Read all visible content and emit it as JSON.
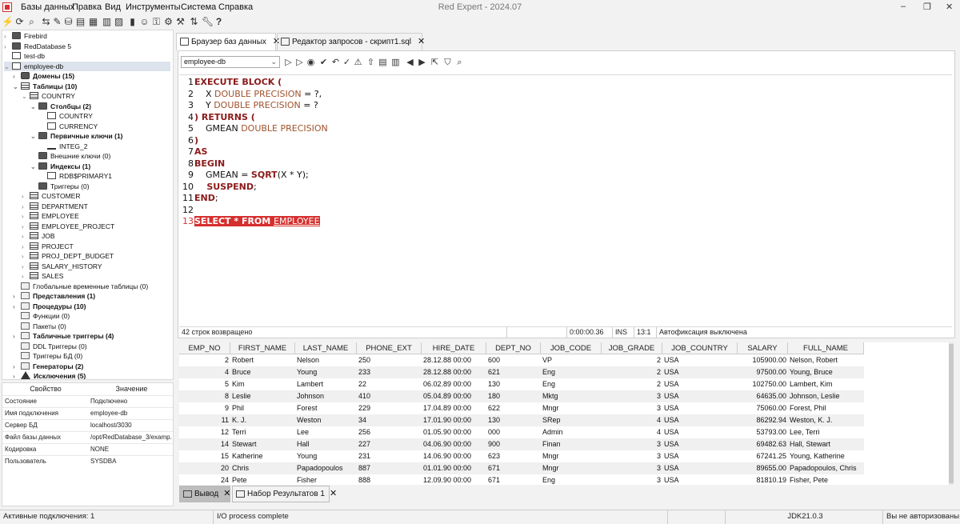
{
  "app": {
    "title": "Red Expert - 2024.07"
  },
  "menu": [
    "Базы данных",
    "Правка",
    "Вид",
    "Инструменты",
    "Система",
    "Справка"
  ],
  "tree": [
    {
      "label": "Firebird",
      "depth": 0,
      "icon": "fld",
      "arrow": "›",
      "bold": false
    },
    {
      "label": "RedDatabase 5",
      "depth": 0,
      "icon": "fld",
      "arrow": "›",
      "bold": false
    },
    {
      "label": "test-db",
      "depth": 0,
      "icon": "col",
      "arrow": "",
      "bold": false
    },
    {
      "label": "employee-db",
      "depth": 0,
      "icon": "col",
      "arrow": "⌄",
      "bold": false,
      "selected": true
    },
    {
      "label": "Домены (15)",
      "depth": 1,
      "icon": "db",
      "arrow": "›",
      "bold": true
    },
    {
      "label": "Таблицы (10)",
      "depth": 1,
      "icon": "tbl",
      "arrow": "⌄",
      "bold": true
    },
    {
      "label": "COUNTRY",
      "depth": 2,
      "icon": "tbl",
      "arrow": "⌄",
      "bold": false
    },
    {
      "label": "Столбцы (2)",
      "depth": 3,
      "icon": "fld",
      "arrow": "⌄",
      "bold": true
    },
    {
      "label": "COUNTRY",
      "depth": 4,
      "icon": "col",
      "arrow": "",
      "bold": false
    },
    {
      "label": "CURRENCY",
      "depth": 4,
      "icon": "col",
      "arrow": "",
      "bold": false
    },
    {
      "label": "Первичные ключи (1)",
      "depth": 3,
      "icon": "fld",
      "arrow": "⌄",
      "bold": true
    },
    {
      "label": "INTEG_2",
      "depth": 4,
      "icon": "key",
      "arrow": "",
      "bold": false
    },
    {
      "label": "Внешние ключи (0)",
      "depth": 3,
      "icon": "fld",
      "arrow": "",
      "bold": false
    },
    {
      "label": "Индексы (1)",
      "depth": 3,
      "icon": "fld",
      "arrow": "⌄",
      "bold": true
    },
    {
      "label": "RDB$PRIMARY1",
      "depth": 4,
      "icon": "col",
      "arrow": "",
      "bold": false
    },
    {
      "label": "Триггеры (0)",
      "depth": 3,
      "icon": "fld",
      "arrow": "",
      "bold": false
    },
    {
      "label": "CUSTOMER",
      "depth": 2,
      "icon": "tbl",
      "arrow": "›",
      "bold": false
    },
    {
      "label": "DEPARTMENT",
      "depth": 2,
      "icon": "tbl",
      "arrow": "›",
      "bold": false
    },
    {
      "label": "EMPLOYEE",
      "depth": 2,
      "icon": "tbl",
      "arrow": "›",
      "bold": false
    },
    {
      "label": "EMPLOYEE_PROJECT",
      "depth": 2,
      "icon": "tbl",
      "arrow": "›",
      "bold": false
    },
    {
      "label": "JOB",
      "depth": 2,
      "icon": "tbl",
      "arrow": "›",
      "bold": false
    },
    {
      "label": "PROJECT",
      "depth": 2,
      "icon": "tbl",
      "arrow": "›",
      "bold": false
    },
    {
      "label": "PROJ_DEPT_BUDGET",
      "depth": 2,
      "icon": "tbl",
      "arrow": "›",
      "bold": false
    },
    {
      "label": "SALARY_HISTORY",
      "depth": 2,
      "icon": "tbl",
      "arrow": "›",
      "bold": false
    },
    {
      "label": "SALES",
      "depth": 2,
      "icon": "tbl",
      "arrow": "›",
      "bold": false
    },
    {
      "label": "Глобальные временные таблицы (0)",
      "depth": 1,
      "icon": "gen",
      "arrow": "",
      "bold": false
    },
    {
      "label": "Представления (1)",
      "depth": 1,
      "icon": "gen",
      "arrow": "›",
      "bold": true
    },
    {
      "label": "Процедуры (10)",
      "depth": 1,
      "icon": "gen",
      "arrow": "›",
      "bold": true
    },
    {
      "label": "Функции (0)",
      "depth": 1,
      "icon": "gen",
      "arrow": "",
      "bold": false
    },
    {
      "label": "Пакеты (0)",
      "depth": 1,
      "icon": "gen",
      "arrow": "",
      "bold": false
    },
    {
      "label": "Табличные триггеры (4)",
      "depth": 1,
      "icon": "gen",
      "arrow": "›",
      "bold": true
    },
    {
      "label": "DDL Триггеры (0)",
      "depth": 1,
      "icon": "gen",
      "arrow": "",
      "bold": false
    },
    {
      "label": "Триггеры БД (0)",
      "depth": 1,
      "icon": "gen",
      "arrow": "",
      "bold": false
    },
    {
      "label": "Генераторы (2)",
      "depth": 1,
      "icon": "gen",
      "arrow": "›",
      "bold": true
    },
    {
      "label": "Исключения (5)",
      "depth": 1,
      "icon": "warn",
      "arrow": "›",
      "bold": true
    }
  ],
  "props": {
    "header_prop": "Свойство",
    "header_val": "Значение",
    "rows": [
      {
        "k": "Состояние",
        "v": "Подключено"
      },
      {
        "k": "Имя подключения",
        "v": "employee-db"
      },
      {
        "k": "Сервер БД",
        "v": "localhost/3030"
      },
      {
        "k": "Файл базы данных",
        "v": "/opt/RedDatabase_3/examp..."
      },
      {
        "k": "Кодировка",
        "v": "NONE"
      },
      {
        "k": "Пользователь",
        "v": "SYSDBA"
      }
    ]
  },
  "tabs": [
    {
      "label": "Браузер баз данных",
      "active": true
    },
    {
      "label": "Редактор запросов - скрипт1.sql",
      "active": false
    }
  ],
  "editor": {
    "connection": "employee-db",
    "lines": [
      [
        [
          "kw",
          "EXECUTE BLOCK ("
        ]
      ],
      [
        [
          "",
          "    X "
        ],
        [
          "ty",
          "DOUBLE PRECISION"
        ],
        [
          "",
          " = ?,"
        ]
      ],
      [
        [
          "",
          "    Y "
        ],
        [
          "ty",
          "DOUBLE PRECISION"
        ],
        [
          "",
          " = ?"
        ]
      ],
      [
        [
          "kw",
          ") RETURNS ("
        ]
      ],
      [
        [
          "",
          "    GMEAN "
        ],
        [
          "ty",
          "DOUBLE PRECISION"
        ]
      ],
      [
        [
          "kw",
          ")"
        ]
      ],
      [
        [
          "kw",
          "AS"
        ]
      ],
      [
        [
          "kw",
          "BEGIN"
        ]
      ],
      [
        [
          "",
          "    GMEAN = "
        ],
        [
          "kw",
          "SQRT"
        ],
        [
          "",
          "(X * Y);"
        ]
      ],
      [
        [
          "kw",
          "    SUSPEND"
        ],
        [
          "",
          ";"
        ]
      ],
      [
        [
          "kw",
          "END"
        ],
        [
          "",
          ";"
        ]
      ],
      [],
      [
        [
          "hl",
          "SELECT * FROM "
        ],
        [
          "hlu",
          "EMPLOYEE"
        ]
      ]
    ],
    "status": {
      "rows": "42 строк возвращено",
      "time": "0:00:00.36",
      "mode": "INS",
      "pos": "13:1",
      "autocommit": "Автофиксация выключена"
    }
  },
  "grid": {
    "columns": [
      "EMP_NO",
      "FIRST_NAME",
      "LAST_NAME",
      "PHONE_EXT",
      "HIRE_DATE",
      "DEPT_NO",
      "JOB_CODE",
      "JOB_GRADE",
      "JOB_COUNTRY",
      "SALARY",
      "FULL_NAME"
    ],
    "rows": [
      [
        "2",
        "Robert",
        "Nelson",
        "250",
        "28.12.88 00:00",
        "600",
        "VP",
        "2",
        "USA",
        "105900.00",
        "Nelson, Robert"
      ],
      [
        "4",
        "Bruce",
        "Young",
        "233",
        "28.12.88 00:00",
        "621",
        "Eng",
        "2",
        "USA",
        "97500.00",
        "Young, Bruce"
      ],
      [
        "5",
        "Kim",
        "Lambert",
        "22",
        "06.02.89 00:00",
        "130",
        "Eng",
        "2",
        "USA",
        "102750.00",
        "Lambert, Kim"
      ],
      [
        "8",
        "Leslie",
        "Johnson",
        "410",
        "05.04.89 00:00",
        "180",
        "Mktg",
        "3",
        "USA",
        "64635.00",
        "Johnson, Leslie"
      ],
      [
        "9",
        "Phil",
        "Forest",
        "229",
        "17.04.89 00:00",
        "622",
        "Mngr",
        "3",
        "USA",
        "75060.00",
        "Forest, Phil"
      ],
      [
        "11",
        "K. J.",
        "Weston",
        "34",
        "17.01.90 00:00",
        "130",
        "SRep",
        "4",
        "USA",
        "86292.94",
        "Weston, K. J."
      ],
      [
        "12",
        "Terri",
        "Lee",
        "256",
        "01.05.90 00:00",
        "000",
        "Admin",
        "4",
        "USA",
        "53793.00",
        "Lee, Terri"
      ],
      [
        "14",
        "Stewart",
        "Hall",
        "227",
        "04.06.90 00:00",
        "900",
        "Finan",
        "3",
        "USA",
        "69482.63",
        "Hall, Stewart"
      ],
      [
        "15",
        "Katherine",
        "Young",
        "231",
        "14.06.90 00:00",
        "623",
        "Mngr",
        "3",
        "USA",
        "67241.25",
        "Young, Katherine"
      ],
      [
        "20",
        "Chris",
        "Papadopoulos",
        "887",
        "01.01.90 00:00",
        "671",
        "Mngr",
        "3",
        "USA",
        "89655.00",
        "Papadopoulos, Chris"
      ],
      [
        "24",
        "Pete",
        "Fisher",
        "888",
        "12.09.90 00:00",
        "671",
        "Eng",
        "3",
        "USA",
        "81810.19",
        "Fisher, Pete"
      ]
    ]
  },
  "bottom_tabs": [
    {
      "label": "Вывод",
      "active": true
    },
    {
      "label": "Набор Результатов 1",
      "active": false
    }
  ],
  "statusbar": {
    "connections": "Активные подключения: 1",
    "io": "I/O process complete",
    "jdk": "JDK21.0.3",
    "auth": "Вы не авторизованы"
  }
}
